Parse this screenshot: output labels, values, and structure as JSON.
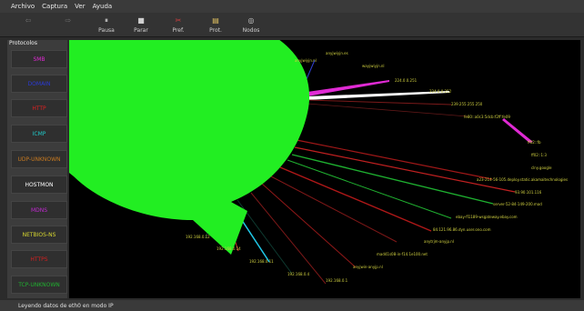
{
  "menu": [
    "Archivo",
    "Captura",
    "Ver",
    "Ayuda"
  ],
  "toolbar": [
    {
      "label": "",
      "icon": "back-icon",
      "glyph": "⇦",
      "enabled": false
    },
    {
      "label": "",
      "icon": "forward-icon",
      "glyph": "⇨",
      "enabled": false
    },
    {
      "label": "Pausa",
      "icon": "pause-icon",
      "glyph": "⏸",
      "enabled": true
    },
    {
      "label": "Parar",
      "icon": "stop-icon",
      "glyph": "■",
      "enabled": true
    },
    {
      "label": "Pref.",
      "icon": "preferences-icon",
      "glyph": "✂",
      "enabled": true
    },
    {
      "label": "Prot.",
      "icon": "protocols-icon",
      "glyph": "▤",
      "enabled": true
    },
    {
      "label": "Nodos",
      "icon": "nodes-icon",
      "glyph": "◎",
      "enabled": true
    }
  ],
  "sidebar": {
    "title": "Protocolos",
    "items": [
      {
        "label": "SMB",
        "color": "#e02ad4"
      },
      {
        "label": "DOMAIN",
        "color": "#2a3ad8"
      },
      {
        "label": "HTTP",
        "color": "#e02020"
      },
      {
        "label": "ICMP",
        "color": "#20c8c8"
      },
      {
        "label": "UDP-UNKNOWN",
        "color": "#c87a20"
      },
      {
        "label": "HOSTMON",
        "color": "#ffffff"
      },
      {
        "label": "MDNS",
        "color": "#c02ad0"
      },
      {
        "label": "NETBIOS-NS",
        "color": "#d8d830"
      },
      {
        "label": "HTTPS",
        "color": "#d02020"
      },
      {
        "label": "TCP-UNKNOWN",
        "color": "#20b030"
      }
    ]
  },
  "graph": {
    "center_node_color": "#22ee22",
    "nodes": [
      {
        "label": "anyjwiyjn.es",
        "color": "#d0d040"
      },
      {
        "label": "anyjwiyjn.nl",
        "color": "#d0d040"
      },
      {
        "label": "wayjwiyjn.nl",
        "color": "#d0d040"
      },
      {
        "label": "224.0.0.251",
        "color": "#d0d040"
      },
      {
        "label": "224.0.0.252",
        "color": "#d0d040"
      },
      {
        "label": "239.255.255.250",
        "color": "#d0d040"
      },
      {
        "label": "fe80::a0c3:5dcb:f2ff:fe09",
        "color": "#d0d040"
      },
      {
        "label": "ff02::fb",
        "color": "#d0d040"
      },
      {
        "label": "ff02::1:3",
        "color": "#d0d040"
      },
      {
        "label": "clny.google",
        "color": "#d0d040"
      },
      {
        "label": "a23-214-56-105.deploy.static.akamaitechnologies",
        "color": "#d0d040"
      },
      {
        "label": "93.90.101.116",
        "color": "#d0d040"
      },
      {
        "label": "server-52-84-149-200.mad",
        "color": "#d0d040"
      },
      {
        "label": "ebay-fl1189-wsgateway.ebay.com",
        "color": "#d0d040"
      },
      {
        "label": "84.121.96.86.dyn.user.ono.com",
        "color": "#d0d040"
      },
      {
        "label": "anytrjm-anyjp.nl",
        "color": "#d0d040"
      },
      {
        "label": "mad41s08-in-f14.1e100.net",
        "color": "#d0d040"
      },
      {
        "label": "anyjwin-anyjp.nl",
        "color": "#d0d040"
      },
      {
        "label": "192.168.0.1",
        "color": "#d0d040"
      },
      {
        "label": "192.168.0.4",
        "color": "#d0d040"
      },
      {
        "label": "192.168.0.11",
        "color": "#d0d040"
      },
      {
        "label": "192.168.0.14",
        "color": "#d0d040"
      },
      {
        "label": "192.168.0.12",
        "color": "#d0d040"
      }
    ]
  },
  "status": "Leyendo datos de eth0 en modo IP"
}
